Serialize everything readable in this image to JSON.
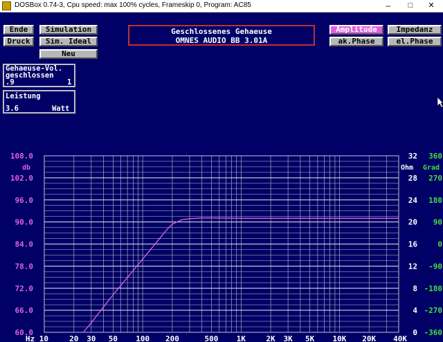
{
  "window": {
    "title": "DOSBox 0.74-3, Cpu speed: max 100% cycles, Frameskip  0, Program:    AC85",
    "minimize": "–",
    "maximize": "□",
    "close": "✕"
  },
  "buttons": {
    "ende": "Ende",
    "simulation": "Simulation",
    "druck": "Druck",
    "sim_ideal": "Sim. Ideal",
    "neu": "Neu",
    "amplitude": "Amplitude",
    "impedanz": "Impedanz",
    "ak_phase": "ak.Phase",
    "el_phase": "el.Phase"
  },
  "header": {
    "line1": "Geschlossenes Gehaeuse",
    "line2": "OMNES AUDIO BB 3.01A"
  },
  "volume_box": {
    "label1": "Gehaeuse-Vol.",
    "label2": "geschlossen",
    "value": ".9",
    "count": "1"
  },
  "power_box": {
    "label": "Leistung",
    "value": "3.6",
    "unit": "Watt"
  },
  "colors": {
    "background": "#000066",
    "magenta": "#e060e0",
    "green": "#40e040",
    "white": "#ffffff",
    "grid": "#c8c8c8"
  },
  "chart_data": {
    "type": "line",
    "xscale": "log",
    "xlim": [
      10,
      40000
    ],
    "ylim": [
      60,
      108
    ],
    "x_ticks": [
      10,
      20,
      30,
      50,
      100,
      200,
      500,
      1000,
      2000,
      3000,
      5000,
      10000,
      20000,
      40000
    ],
    "x_tick_labels": [
      "Hz 10",
      "20",
      "30",
      "50",
      "100",
      "200",
      "500",
      "1K",
      "2K",
      "3K",
      "5K",
      "10K",
      "20K",
      "40K"
    ],
    "left_axis": {
      "unit": "db",
      "ticks": [
        108,
        102,
        96,
        90,
        84,
        78,
        72,
        66,
        60
      ],
      "tick_labels": [
        "108.0",
        "102.0",
        "96.0",
        "90.0",
        "84.0",
        "78.0",
        "72.0",
        "66.0",
        "60.0"
      ]
    },
    "impedance_axis": {
      "unit": "Ohm",
      "ticks": [
        32,
        28,
        24,
        20,
        16,
        12,
        8,
        4,
        0
      ],
      "tick_labels": [
        "32",
        "28",
        "24",
        "20",
        "16",
        "12",
        "8",
        "4",
        "0"
      ]
    },
    "phase_axis": {
      "unit": "Grad",
      "ticks": [
        360,
        270,
        180,
        90,
        0,
        -90,
        -180,
        -270,
        -360
      ],
      "tick_labels": [
        "360",
        "270",
        "180",
        "90",
        "0",
        "-90",
        "-180",
        "-270",
        "-360"
      ]
    },
    "series": [
      {
        "color": "#e060e0",
        "x": [
          25,
          30,
          40,
          50,
          70,
          100,
          130,
          160,
          180,
          200,
          250,
          300,
          400,
          500,
          1000,
          5000,
          40000
        ],
        "y": [
          60,
          62.6,
          66.9,
          70.2,
          74.9,
          79.9,
          83.6,
          86.6,
          88.2,
          89.4,
          90.6,
          90.9,
          91.1,
          91.1,
          91.0,
          91.0,
          91.0
        ]
      }
    ]
  }
}
